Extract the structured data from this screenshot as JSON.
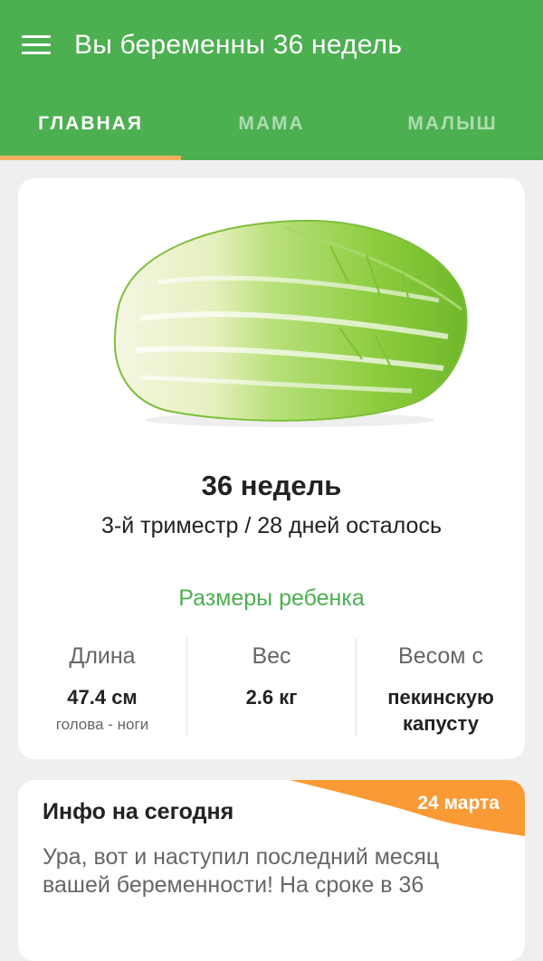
{
  "header": {
    "title": "Вы беременны 36 недель",
    "menu_icon": "hamburger-menu-icon",
    "brand_color": "#4caf50",
    "accent_color": "#f7b15c"
  },
  "tabs": [
    {
      "label": "ГЛАВНАЯ",
      "active": true
    },
    {
      "label": "МАМА",
      "active": false
    },
    {
      "label": "МАЛЫШ",
      "active": false
    }
  ],
  "week_card": {
    "image": "napa-cabbage-image",
    "week_title": "36 недель",
    "week_subtitle": "3-й триместр / 28 дней осталось",
    "sizes_title": "Размеры ребенка",
    "stats": [
      {
        "label": "Длина",
        "value": "47.4 см",
        "note": "голова - ноги"
      },
      {
        "label": "Вес",
        "value": "2.6 кг",
        "note": ""
      },
      {
        "label": "Весом с",
        "value": "пекинскую капусту",
        "note": ""
      }
    ]
  },
  "info_card": {
    "title": "Инфо на сегодня",
    "date": "24 марта",
    "text": "Ура, вот и наступил последний месяц вашей беременности! На сроке в 36"
  }
}
